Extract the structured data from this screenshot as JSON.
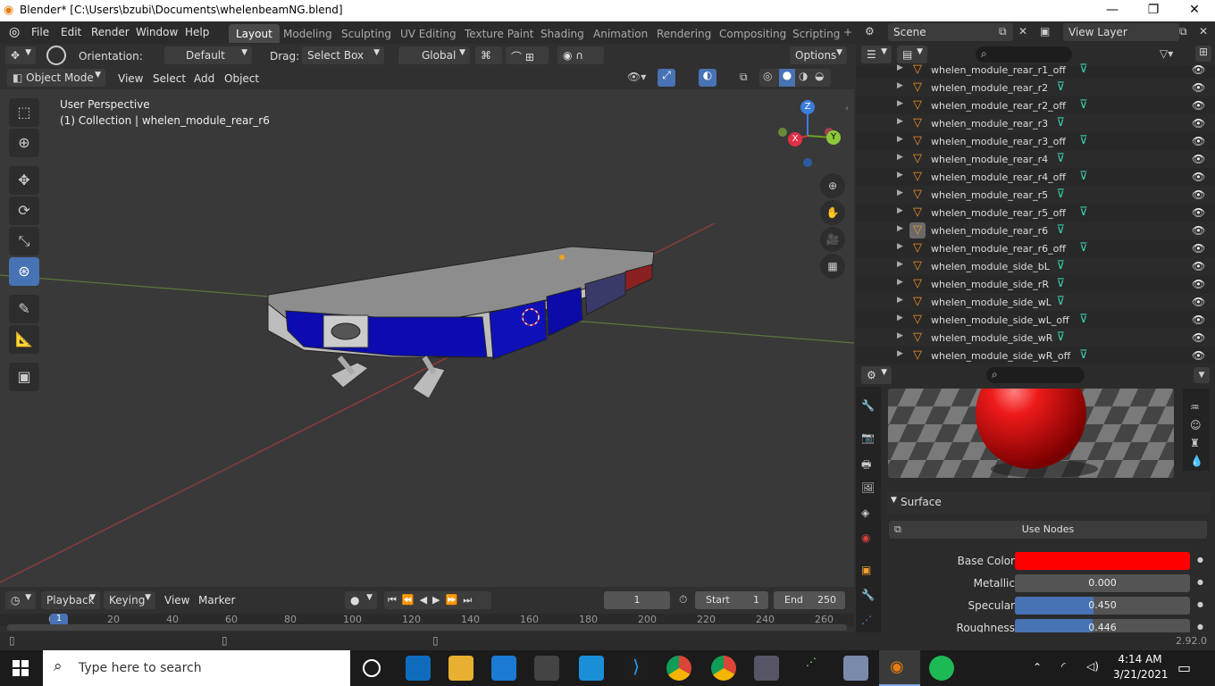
{
  "window": {
    "title": "Blender* [C:\\Users\\bzubi\\Documents\\whelenbeamNG.blend]",
    "min": "—",
    "max": "❐",
    "close": "✕"
  },
  "menubar": {
    "items": [
      "File",
      "Edit",
      "Render",
      "Window",
      "Help"
    ]
  },
  "workspaces": [
    "Layout",
    "Modeling",
    "Sculpting",
    "UV Editing",
    "Texture Paint",
    "Shading",
    "Animation",
    "Rendering",
    "Compositing",
    "Scripting"
  ],
  "active_workspace": "Layout",
  "scene": {
    "name": "Scene",
    "view_layer": "View Layer"
  },
  "tool_header": {
    "orientation_label": "Orientation:",
    "orientation_value": "Default",
    "drag_label": "Drag:",
    "drag_value": "Select Box",
    "transform_value": "Global",
    "options": "Options"
  },
  "viewport_header": {
    "mode": "Object Mode",
    "menus": [
      "View",
      "Select",
      "Add",
      "Object"
    ]
  },
  "viewport": {
    "perspective": "User Perspective",
    "collection_info": "(1) Collection | whelen_module_rear_r6",
    "gizmo": {
      "x": "X",
      "y": "Y",
      "z": "Z"
    }
  },
  "outliner": {
    "items": [
      "whelen_module_rear_r1_off",
      "whelen_module_rear_r2",
      "whelen_module_rear_r2_off",
      "whelen_module_rear_r3",
      "whelen_module_rear_r3_off",
      "whelen_module_rear_r4",
      "whelen_module_rear_r4_off",
      "whelen_module_rear_r5",
      "whelen_module_rear_r5_off",
      "whelen_module_rear_r6",
      "whelen_module_rear_r6_off",
      "whelen_module_side_bL",
      "whelen_module_side_rR",
      "whelen_module_side_wL",
      "whelen_module_side_wL_off",
      "whelen_module_side_wR",
      "whelen_module_side_wR_off"
    ],
    "selected_index": 9
  },
  "properties": {
    "section": "Surface",
    "use_nodes": "Use Nodes",
    "fields": [
      {
        "label": "Base Color",
        "value": "",
        "color": "#ff0000"
      },
      {
        "label": "Metallic",
        "value": "0.000",
        "fill": 0
      },
      {
        "label": "Specular",
        "value": "0.450",
        "fill": 0.45
      },
      {
        "label": "Roughness",
        "value": "0.446",
        "fill": 0.446
      }
    ]
  },
  "timeline": {
    "menus": [
      "Playback",
      "Keying",
      "View",
      "Marker"
    ],
    "current_frame": "1",
    "start_label": "Start",
    "start": "1",
    "end_label": "End",
    "end": "250",
    "ticks": [
      "0",
      "20",
      "40",
      "60",
      "80",
      "100",
      "120",
      "140",
      "160",
      "180",
      "200",
      "220",
      "240",
      "260"
    ],
    "marker": "1"
  },
  "statusbar": {
    "version": "2.92.0"
  },
  "taskbar": {
    "search_placeholder": "Type here to search",
    "time": "4:14 AM",
    "date": "3/21/2021"
  }
}
